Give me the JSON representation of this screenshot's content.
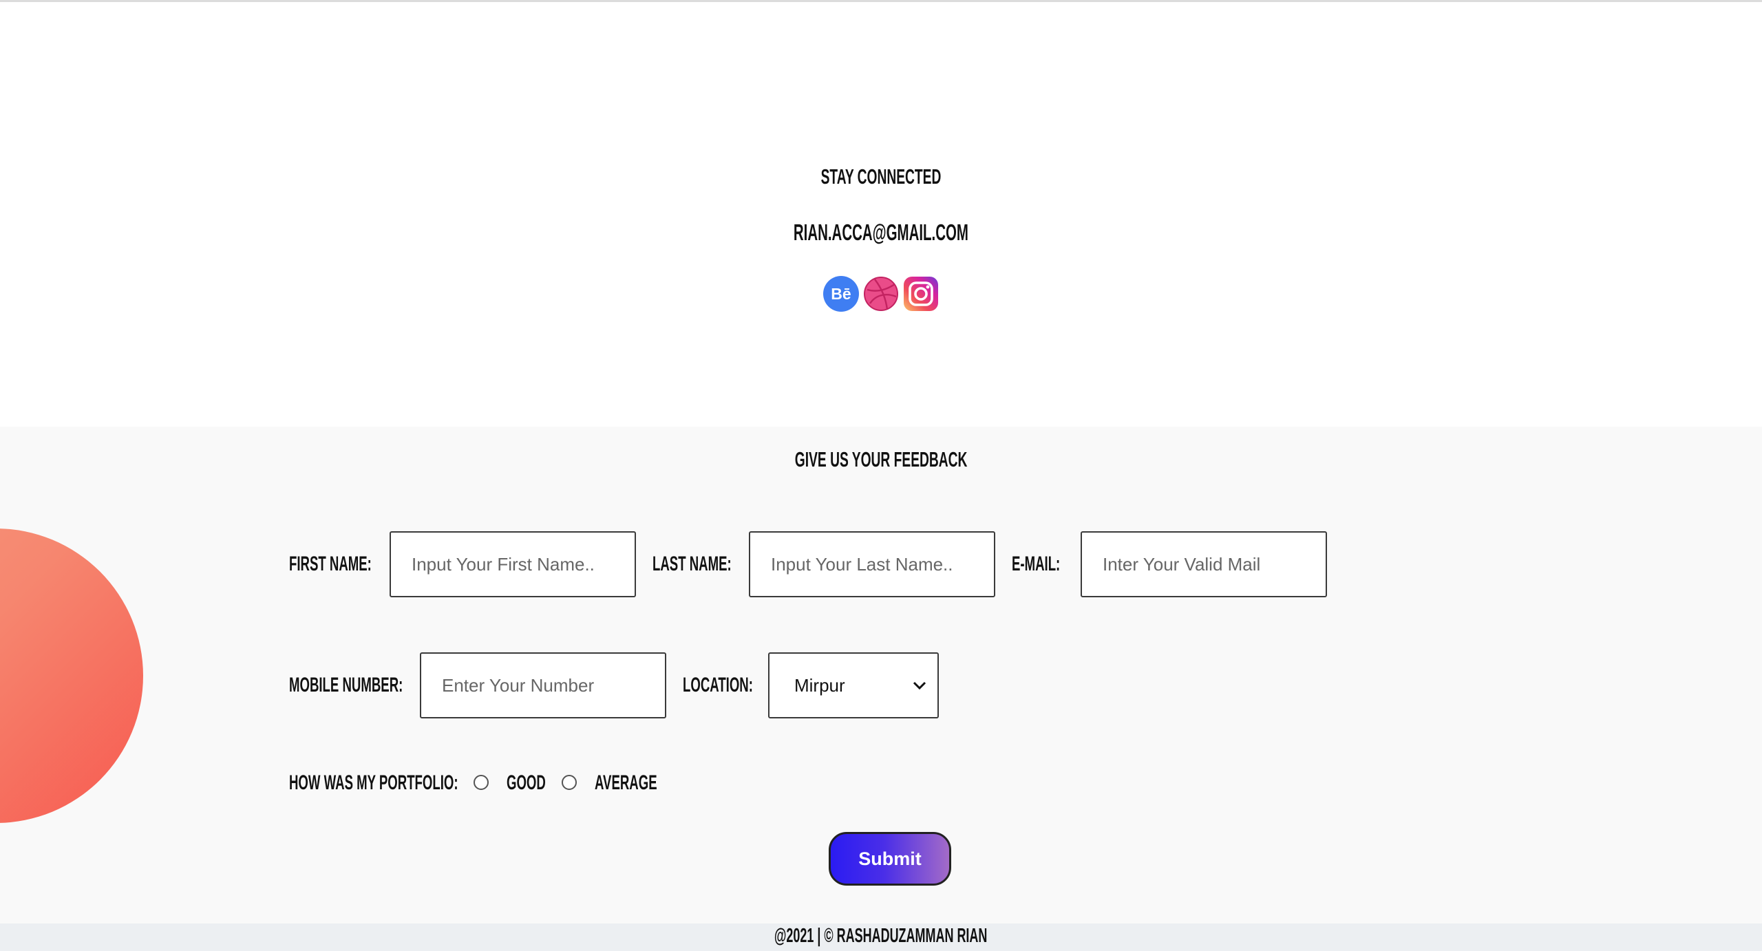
{
  "stay": {
    "title": "STAY CONNECTED",
    "email": "RIAN.ACCA@GMAIL.COM",
    "social": [
      {
        "name": "behance-icon",
        "glyph": "Bē",
        "color": "#3f7ef2"
      },
      {
        "name": "dribbble-icon",
        "color": "#ea4c89"
      },
      {
        "name": "instagram-icon",
        "color": "#d6249f"
      }
    ]
  },
  "feedback": {
    "title": "GIVE US YOUR FEEDBACK",
    "first_name": {
      "label": "FIRST NAME:",
      "placeholder": "Input Your First Name.."
    },
    "last_name": {
      "label": "LAST NAME:",
      "placeholder": "Input Your Last Name.."
    },
    "email": {
      "label": "E-MAIL:",
      "placeholder": "Inter Your Valid Mail"
    },
    "mobile": {
      "label": "MOBILE NUMBER:",
      "placeholder": "Enter Your Number"
    },
    "location": {
      "label": "LOCATION:",
      "value": "Mirpur"
    },
    "rating": {
      "label": "HOW WAS MY PORTFOLIO:",
      "options": [
        "GOOD",
        "AVERAGE"
      ]
    },
    "submit_label": "Submit"
  },
  "footer": {
    "text": "@2021 | © RASHADUZAMMAN RIAN"
  },
  "colors": {
    "accent_circle": "#f6866f",
    "submit_gradient_start": "#2b1cf2",
    "submit_gradient_end": "#a36bc8",
    "feedback_bg": "#f9f9f9",
    "footer_bg": "#eceff2"
  }
}
